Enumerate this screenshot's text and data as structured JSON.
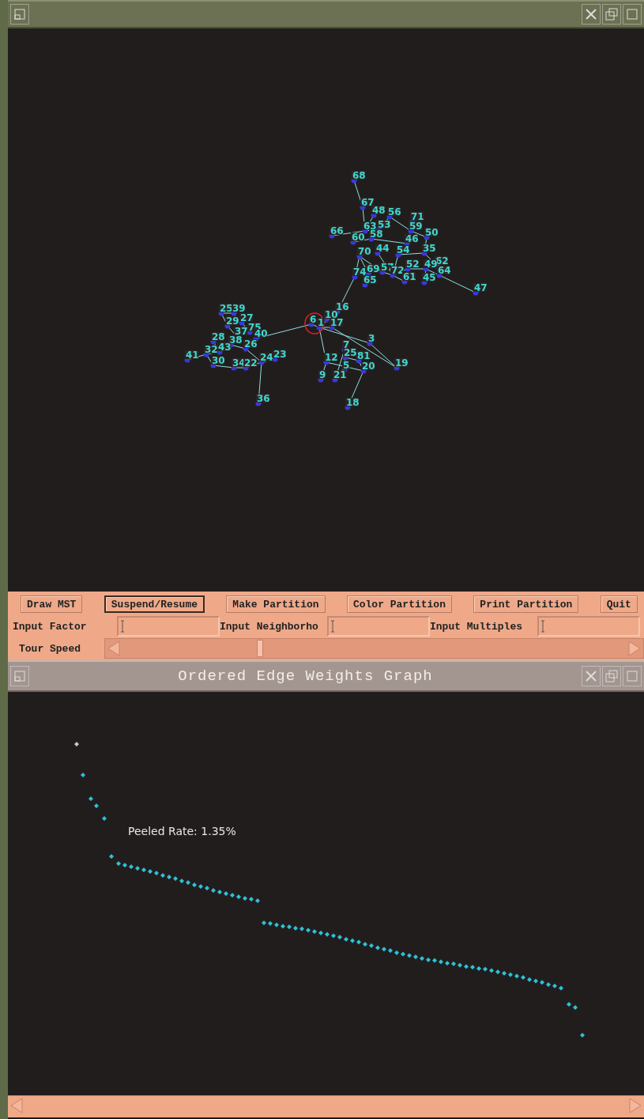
{
  "network_window": {
    "graph": {
      "nodes": [
        {
          "label": "68"
        },
        {
          "label": "67"
        },
        {
          "label": "48"
        },
        {
          "label": "56"
        },
        {
          "label": "63"
        },
        {
          "label": "53"
        },
        {
          "label": "66"
        },
        {
          "label": "60"
        },
        {
          "label": "58"
        },
        {
          "label": "71"
        },
        {
          "label": "59"
        },
        {
          "label": "50"
        },
        {
          "label": "46"
        },
        {
          "label": "44"
        },
        {
          "label": "70"
        },
        {
          "label": "54"
        },
        {
          "label": "35"
        },
        {
          "label": "62"
        },
        {
          "label": "74"
        },
        {
          "label": "69"
        },
        {
          "label": "57"
        },
        {
          "label": "72"
        },
        {
          "label": "52"
        },
        {
          "label": "49"
        },
        {
          "label": "64"
        },
        {
          "label": "65"
        },
        {
          "label": "61"
        },
        {
          "label": "45"
        },
        {
          "label": "47"
        },
        {
          "label": "16"
        },
        {
          "label": "10"
        },
        {
          "label": "6"
        },
        {
          "label": "1"
        },
        {
          "label": "17"
        },
        {
          "label": "3"
        },
        {
          "label": "7"
        },
        {
          "label": "12"
        },
        {
          "label": "25"
        },
        {
          "label": "81"
        },
        {
          "label": "5"
        },
        {
          "label": "20"
        },
        {
          "label": "19"
        },
        {
          "label": "9"
        },
        {
          "label": "21"
        },
        {
          "label": "18"
        },
        {
          "label": "25"
        },
        {
          "label": "39"
        },
        {
          "label": "29"
        },
        {
          "label": "27"
        },
        {
          "label": "75"
        },
        {
          "label": "37"
        },
        {
          "label": "28"
        },
        {
          "label": "38"
        },
        {
          "label": "26"
        },
        {
          "label": "40"
        },
        {
          "label": "41"
        },
        {
          "label": "32"
        },
        {
          "label": "43"
        },
        {
          "label": "30"
        },
        {
          "label": "34"
        },
        {
          "label": "22"
        },
        {
          "label": "24"
        },
        {
          "label": "23"
        },
        {
          "label": "36"
        }
      ]
    },
    "controls": {
      "buttons": [
        {
          "label": "Draw MST",
          "selected": false
        },
        {
          "label": "Suspend/Resume",
          "selected": true
        },
        {
          "label": "Make Partition",
          "selected": false
        },
        {
          "label": "Color Partition",
          "selected": false
        },
        {
          "label": "Print Partition",
          "selected": false
        },
        {
          "label": "Quit",
          "selected": false
        }
      ],
      "inputs": [
        {
          "label": "Input Factor"
        },
        {
          "label": "Input Neighborho"
        },
        {
          "label": "Input Multiples"
        }
      ],
      "tour_speed": {
        "label": "Tour Speed",
        "level": 0.27
      }
    }
  },
  "graph_window": {
    "title": "Ordered Edge Weights Graph",
    "annotation": "Peeled Rate: 1.35%"
  }
}
